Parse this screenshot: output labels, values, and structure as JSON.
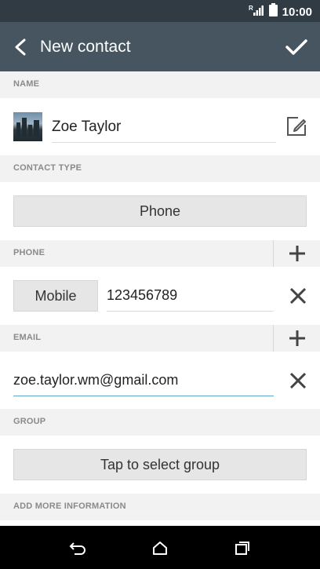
{
  "status_bar": {
    "time": "10:00",
    "icons": [
      "signal-icon",
      "battery-icon"
    ]
  },
  "app_bar": {
    "title": "New contact",
    "back_icon": "back-arrow-icon",
    "done_icon": "checkmark-icon"
  },
  "sections": {
    "name": {
      "label": "NAME",
      "value": "Zoe Taylor"
    },
    "contact_type": {
      "label": "CONTACT TYPE",
      "value": "Phone"
    },
    "phone": {
      "label": "PHONE",
      "type": "Mobile",
      "value": "123456789"
    },
    "email": {
      "label": "EMAIL",
      "value": "zoe.taylor.wm@gmail.com"
    },
    "group": {
      "label": "GROUP",
      "placeholder": "Tap to select group"
    },
    "more": {
      "label": "ADD MORE INFORMATION"
    }
  },
  "colors": {
    "app_bar": "#46555f",
    "status_bar": "#313b44",
    "focus_underline": "#5fa8c9"
  }
}
